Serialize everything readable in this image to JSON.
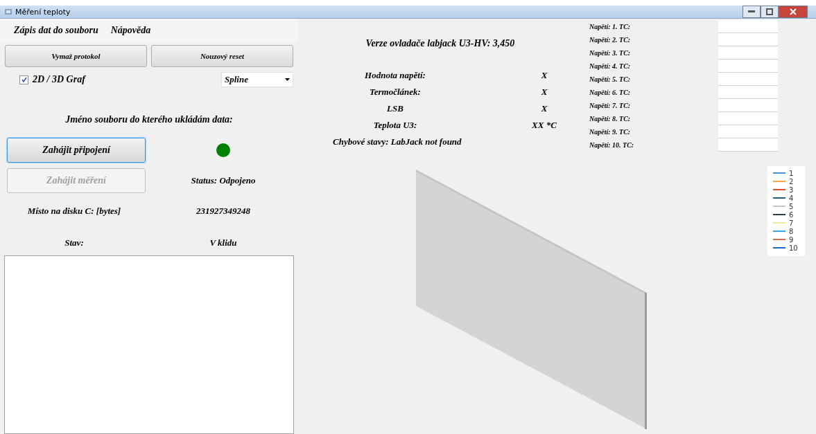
{
  "window": {
    "title": "Měření teploty"
  },
  "menu": [
    {
      "label": "Zápis dat do souboru"
    },
    {
      "label": "Nápověda"
    }
  ],
  "buttons": [
    {
      "label": "Vymaž protokol"
    },
    {
      "label": "Nouzový reset"
    }
  ],
  "graph_toggle": {
    "label": "2D / 3D Graf",
    "checked": true
  },
  "chart_type": {
    "value": "Spline"
  },
  "file_label": "Jméno souboru do kterého ukládám data:",
  "connect_button": {
    "label": "Zahájit připojení",
    "disabled": false,
    "focused": true
  },
  "connection_dot": {
    "color": "#008000"
  },
  "measure_button": {
    "label": "Zahájit měření",
    "disabled": true,
    "focused": false
  },
  "status": "Status: Odpojeno",
  "disk": {
    "label": "Místo na disku C: [bytes]",
    "value": "231927349248"
  },
  "state": {
    "label": "Stav:",
    "value": "V klidu"
  },
  "driver_version": "Verze ovladače labjack U3-HV: 3,450",
  "readings": [
    {
      "label": "Hodnota napětí:",
      "value": "X"
    },
    {
      "label": "Termočlánek:",
      "value": "X"
    },
    {
      "label": "LSB",
      "value": "X"
    },
    {
      "label": "Teplota U3:",
      "value": "XX *C"
    }
  ],
  "error_state": "Chybové stavy: LabJack not found",
  "tc_fields": [
    {
      "label": "Napětí: 1. TC:"
    },
    {
      "label": "Napětí: 2. TC:"
    },
    {
      "label": "Napětí: 3. TC:"
    },
    {
      "label": "Napětí: 4. TC:"
    },
    {
      "label": "Napětí: 5. TC:"
    },
    {
      "label": "Napětí: 6. TC:"
    },
    {
      "label": "Napětí: 7. TC:"
    },
    {
      "label": "Napětí: 8. TC:"
    },
    {
      "label": "Napětí: 9. TC:"
    },
    {
      "label": "Napětí: 10. TC:"
    }
  ],
  "legend": [
    {
      "label": "1",
      "color": "#4a90e2"
    },
    {
      "label": "2",
      "color": "#f5a94a"
    },
    {
      "label": "3",
      "color": "#e0502a"
    },
    {
      "label": "4",
      "color": "#1f5f8b"
    },
    {
      "label": "5",
      "color": "#c8c8c8"
    },
    {
      "label": "6",
      "color": "#2c3e5a"
    },
    {
      "label": "7",
      "color": "#fbe49a"
    },
    {
      "label": "8",
      "color": "#3aa8e0"
    },
    {
      "label": "9",
      "color": "#d0704a"
    },
    {
      "label": "10",
      "color": "#1a64d6"
    }
  ]
}
